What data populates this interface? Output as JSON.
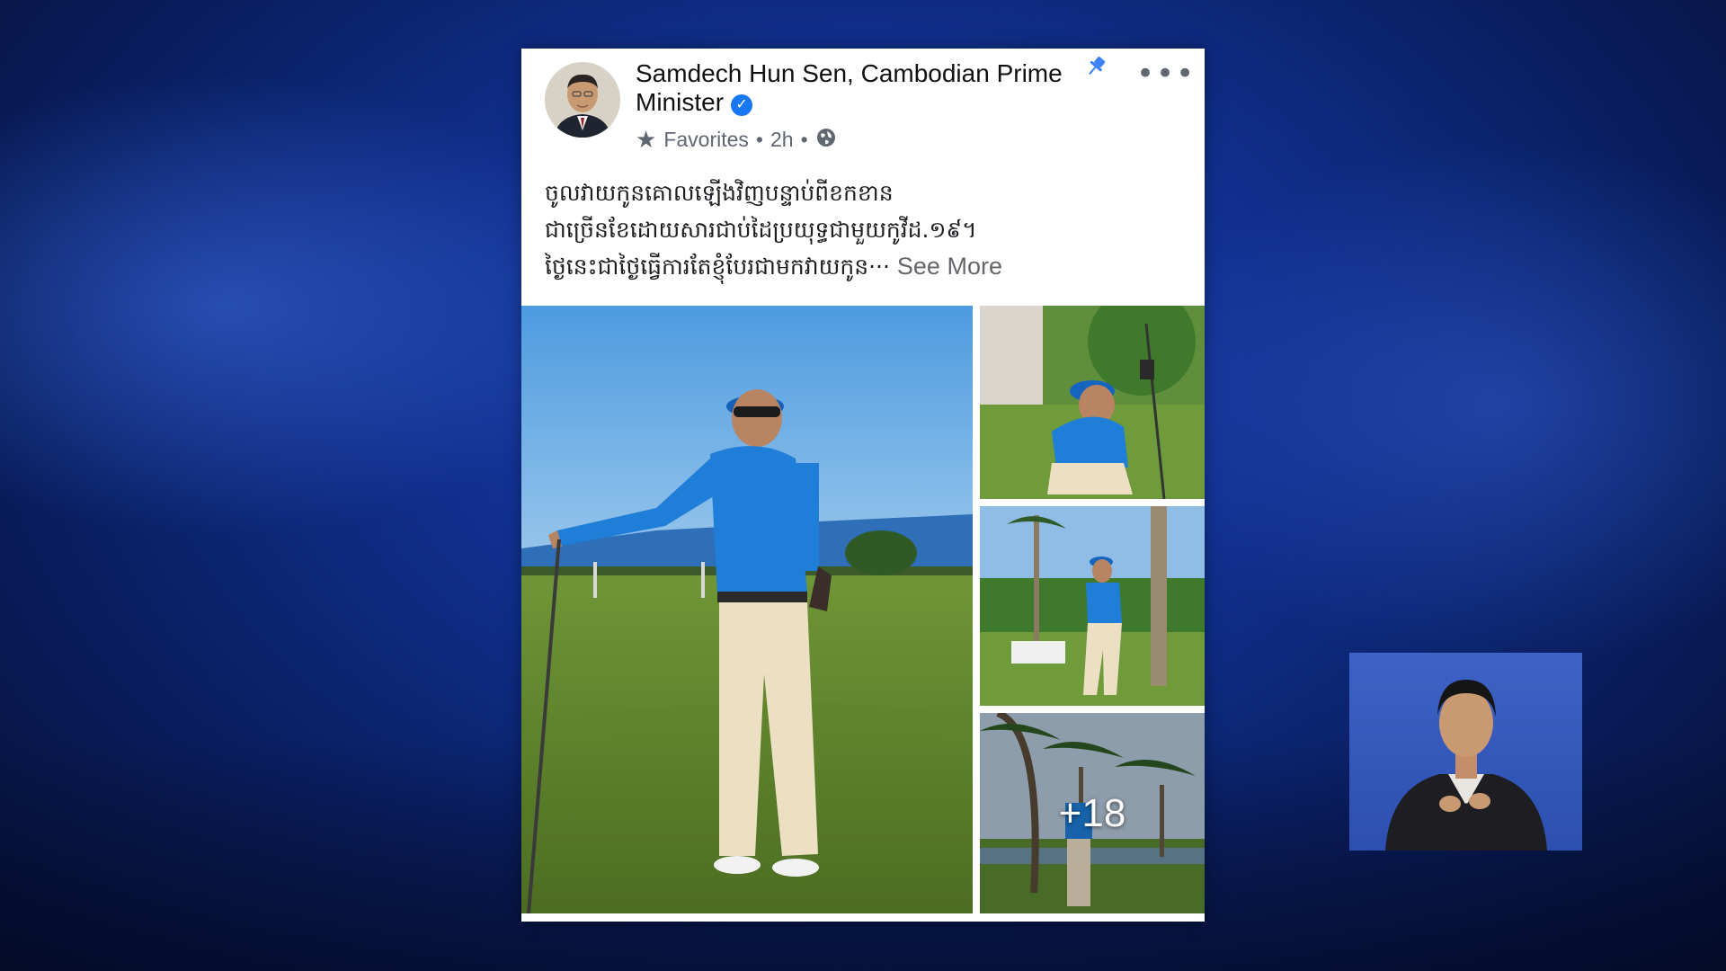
{
  "post": {
    "author": "Samdech Hun Sen, Cambodian Prime Minister",
    "audience": "Favorites",
    "time": "2h",
    "text_lines": [
      "ចូលវាយកូនគោលឡើងវិញបន្ទាប់ពីខកខាន",
      "ជាច្រើនខែដោយសារជាប់ដៃប្រយុទ្ធជាមួយកូវីដ.១៩។",
      "ថ្ងៃនេះជាថ្ងៃធ្វើការតែខ្ញុំបែរជាមកវាយកូន···"
    ],
    "see_more": "See More",
    "more_photos": "+18"
  },
  "icons": {
    "verified": "verified-badge-icon",
    "audience": "star-icon",
    "privacy": "globe-icon",
    "pin": "pin-icon",
    "more": "more-options-icon"
  },
  "colors": {
    "facebook_blue": "#1877f2",
    "meta_gray": "#606770",
    "background_blue": "#11308f"
  }
}
